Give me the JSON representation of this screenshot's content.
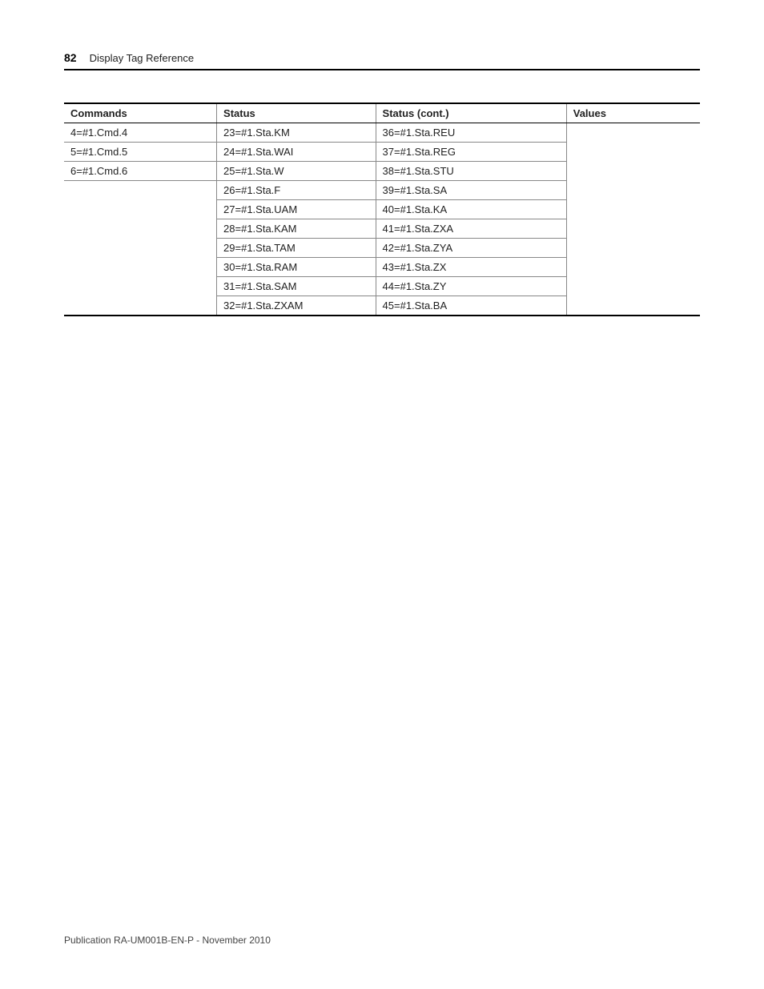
{
  "header": {
    "page_number": "82",
    "section": "Display Tag Reference"
  },
  "table": {
    "headers": {
      "commands": "Commands",
      "status": "Status",
      "status_cont": "Status (cont.)",
      "values": "Values"
    },
    "rows": [
      {
        "commands": "4=#1.Cmd.4",
        "status": "23=#1.Sta.KM",
        "status_cont": "36=#1.Sta.REU",
        "values": ""
      },
      {
        "commands": "5=#1.Cmd.5",
        "status": "24=#1.Sta.WAI",
        "status_cont": "37=#1.Sta.REG",
        "values": ""
      },
      {
        "commands": "6=#1.Cmd.6",
        "status": "25=#1.Sta.W",
        "status_cont": "38=#1.Sta.STU",
        "values": ""
      },
      {
        "commands": "",
        "status": "26=#1.Sta.F",
        "status_cont": "39=#1.Sta.SA",
        "values": ""
      },
      {
        "commands": "",
        "status": "27=#1.Sta.UAM",
        "status_cont": "40=#1.Sta.KA",
        "values": ""
      },
      {
        "commands": "",
        "status": "28=#1.Sta.KAM",
        "status_cont": "41=#1.Sta.ZXA",
        "values": ""
      },
      {
        "commands": "",
        "status": "29=#1.Sta.TAM",
        "status_cont": "42=#1.Sta.ZYA",
        "values": ""
      },
      {
        "commands": "",
        "status": "30=#1.Sta.RAM",
        "status_cont": "43=#1.Sta.ZX",
        "values": ""
      },
      {
        "commands": "",
        "status": "31=#1.Sta.SAM",
        "status_cont": "44=#1.Sta.ZY",
        "values": ""
      },
      {
        "commands": "",
        "status": "32=#1.Sta.ZXAM",
        "status_cont": "45=#1.Sta.BA",
        "values": ""
      }
    ]
  },
  "footer": {
    "publication": "Publication RA-UM001B-EN-P - November 2010"
  }
}
